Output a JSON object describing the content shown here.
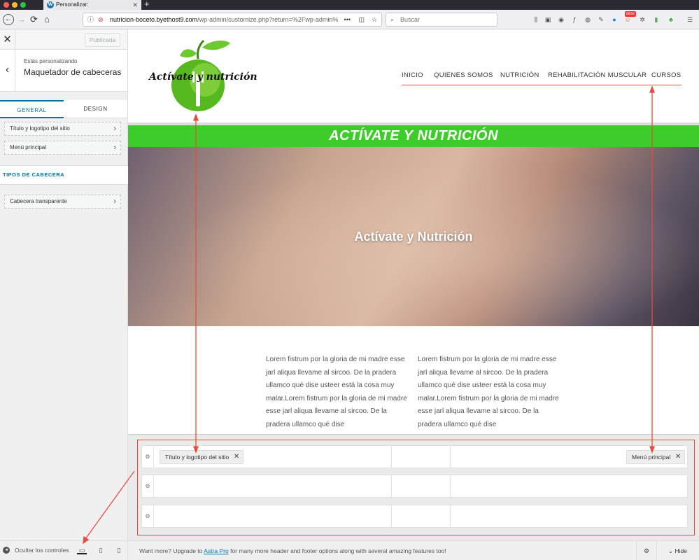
{
  "browser": {
    "tab_title": "Personalizar:",
    "url_domain": "nutricion-boceto.byethost9.com",
    "url_path": "/wp-admin/customize.php?return=%2Fwp-admin%",
    "search_placeholder": "Buscar",
    "addon_badge": "desc"
  },
  "sidebar": {
    "publish_label": "Publicada",
    "customizing_label": "Estás personalizando",
    "panel_title": "Maquetador de cabeceras",
    "tabs": [
      "GENERAL",
      "DESIGN"
    ],
    "sections": [
      "Título y logotipo del sitio",
      "Menú principal"
    ],
    "group_title": "TIPOS DE CABECERA",
    "sub_sections": [
      "Cabecera transparente"
    ],
    "hide_controls_label": "Ocultar los controles"
  },
  "preview": {
    "logo_text": "Actívate y nutrición",
    "menu": [
      "INICIO",
      "QUIENES SOMOS",
      "NUTRICIÓN",
      "REHABILITACIÓN MUSCULAR",
      "CURSOS"
    ],
    "banner_title": "ACTÍVATE Y NUTRICIÓN",
    "hero_title": "Actívate y Nutrición",
    "column_text": "Lorem fistrum por la gloria de mi madre esse jarl aliqua llevame al sircoo. De la pradera ullamco qué dise usteer está la cosa muy malar.Lorem fistrum por la gloria de mi madre esse jarl aliqua llevame al sircoo. De la pradera ullamco qué dise"
  },
  "builder": {
    "left_chip": "Título y logotipo del sitio",
    "right_chip": "Menú principal"
  },
  "footer": {
    "pre": "Want more? Upgrade to ",
    "link": "Astra Pro",
    "post": " for many more header and footer options along with several amazing features too!",
    "hide_label": "Hide"
  },
  "colors": {
    "green": "#3dcc2a",
    "wp_blue": "#0073aa",
    "annotation_red": "#e74c3c"
  }
}
